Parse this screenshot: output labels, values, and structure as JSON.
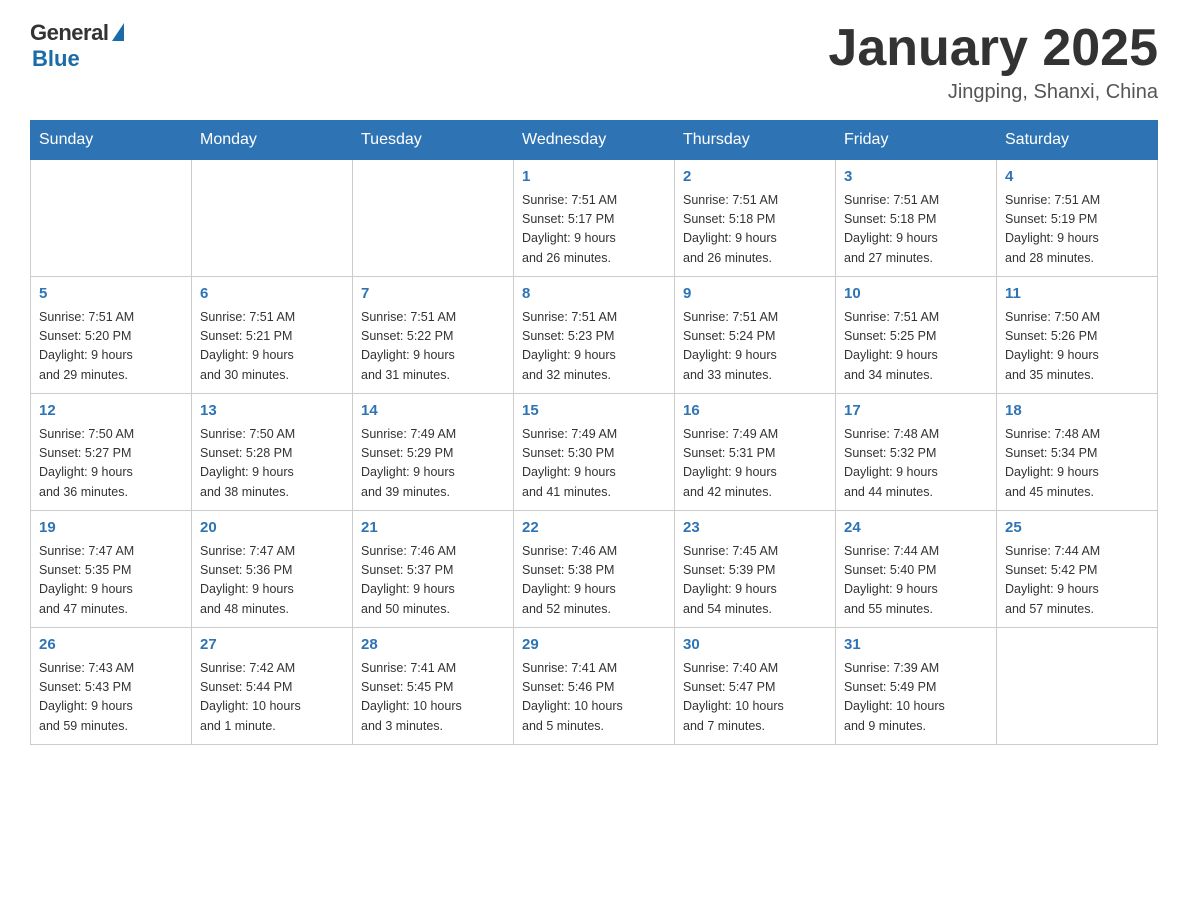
{
  "logo": {
    "general": "General",
    "blue": "Blue",
    "tagline": "Blue"
  },
  "header": {
    "title": "January 2025",
    "location": "Jingping, Shanxi, China"
  },
  "days_of_week": [
    "Sunday",
    "Monday",
    "Tuesday",
    "Wednesday",
    "Thursday",
    "Friday",
    "Saturday"
  ],
  "weeks": [
    [
      {
        "day": "",
        "info": ""
      },
      {
        "day": "",
        "info": ""
      },
      {
        "day": "",
        "info": ""
      },
      {
        "day": "1",
        "info": "Sunrise: 7:51 AM\nSunset: 5:17 PM\nDaylight: 9 hours\nand 26 minutes."
      },
      {
        "day": "2",
        "info": "Sunrise: 7:51 AM\nSunset: 5:18 PM\nDaylight: 9 hours\nand 26 minutes."
      },
      {
        "day": "3",
        "info": "Sunrise: 7:51 AM\nSunset: 5:18 PM\nDaylight: 9 hours\nand 27 minutes."
      },
      {
        "day": "4",
        "info": "Sunrise: 7:51 AM\nSunset: 5:19 PM\nDaylight: 9 hours\nand 28 minutes."
      }
    ],
    [
      {
        "day": "5",
        "info": "Sunrise: 7:51 AM\nSunset: 5:20 PM\nDaylight: 9 hours\nand 29 minutes."
      },
      {
        "day": "6",
        "info": "Sunrise: 7:51 AM\nSunset: 5:21 PM\nDaylight: 9 hours\nand 30 minutes."
      },
      {
        "day": "7",
        "info": "Sunrise: 7:51 AM\nSunset: 5:22 PM\nDaylight: 9 hours\nand 31 minutes."
      },
      {
        "day": "8",
        "info": "Sunrise: 7:51 AM\nSunset: 5:23 PM\nDaylight: 9 hours\nand 32 minutes."
      },
      {
        "day": "9",
        "info": "Sunrise: 7:51 AM\nSunset: 5:24 PM\nDaylight: 9 hours\nand 33 minutes."
      },
      {
        "day": "10",
        "info": "Sunrise: 7:51 AM\nSunset: 5:25 PM\nDaylight: 9 hours\nand 34 minutes."
      },
      {
        "day": "11",
        "info": "Sunrise: 7:50 AM\nSunset: 5:26 PM\nDaylight: 9 hours\nand 35 minutes."
      }
    ],
    [
      {
        "day": "12",
        "info": "Sunrise: 7:50 AM\nSunset: 5:27 PM\nDaylight: 9 hours\nand 36 minutes."
      },
      {
        "day": "13",
        "info": "Sunrise: 7:50 AM\nSunset: 5:28 PM\nDaylight: 9 hours\nand 38 minutes."
      },
      {
        "day": "14",
        "info": "Sunrise: 7:49 AM\nSunset: 5:29 PM\nDaylight: 9 hours\nand 39 minutes."
      },
      {
        "day": "15",
        "info": "Sunrise: 7:49 AM\nSunset: 5:30 PM\nDaylight: 9 hours\nand 41 minutes."
      },
      {
        "day": "16",
        "info": "Sunrise: 7:49 AM\nSunset: 5:31 PM\nDaylight: 9 hours\nand 42 minutes."
      },
      {
        "day": "17",
        "info": "Sunrise: 7:48 AM\nSunset: 5:32 PM\nDaylight: 9 hours\nand 44 minutes."
      },
      {
        "day": "18",
        "info": "Sunrise: 7:48 AM\nSunset: 5:34 PM\nDaylight: 9 hours\nand 45 minutes."
      }
    ],
    [
      {
        "day": "19",
        "info": "Sunrise: 7:47 AM\nSunset: 5:35 PM\nDaylight: 9 hours\nand 47 minutes."
      },
      {
        "day": "20",
        "info": "Sunrise: 7:47 AM\nSunset: 5:36 PM\nDaylight: 9 hours\nand 48 minutes."
      },
      {
        "day": "21",
        "info": "Sunrise: 7:46 AM\nSunset: 5:37 PM\nDaylight: 9 hours\nand 50 minutes."
      },
      {
        "day": "22",
        "info": "Sunrise: 7:46 AM\nSunset: 5:38 PM\nDaylight: 9 hours\nand 52 minutes."
      },
      {
        "day": "23",
        "info": "Sunrise: 7:45 AM\nSunset: 5:39 PM\nDaylight: 9 hours\nand 54 minutes."
      },
      {
        "day": "24",
        "info": "Sunrise: 7:44 AM\nSunset: 5:40 PM\nDaylight: 9 hours\nand 55 minutes."
      },
      {
        "day": "25",
        "info": "Sunrise: 7:44 AM\nSunset: 5:42 PM\nDaylight: 9 hours\nand 57 minutes."
      }
    ],
    [
      {
        "day": "26",
        "info": "Sunrise: 7:43 AM\nSunset: 5:43 PM\nDaylight: 9 hours\nand 59 minutes."
      },
      {
        "day": "27",
        "info": "Sunrise: 7:42 AM\nSunset: 5:44 PM\nDaylight: 10 hours\nand 1 minute."
      },
      {
        "day": "28",
        "info": "Sunrise: 7:41 AM\nSunset: 5:45 PM\nDaylight: 10 hours\nand 3 minutes."
      },
      {
        "day": "29",
        "info": "Sunrise: 7:41 AM\nSunset: 5:46 PM\nDaylight: 10 hours\nand 5 minutes."
      },
      {
        "day": "30",
        "info": "Sunrise: 7:40 AM\nSunset: 5:47 PM\nDaylight: 10 hours\nand 7 minutes."
      },
      {
        "day": "31",
        "info": "Sunrise: 7:39 AM\nSunset: 5:49 PM\nDaylight: 10 hours\nand 9 minutes."
      },
      {
        "day": "",
        "info": ""
      }
    ]
  ]
}
